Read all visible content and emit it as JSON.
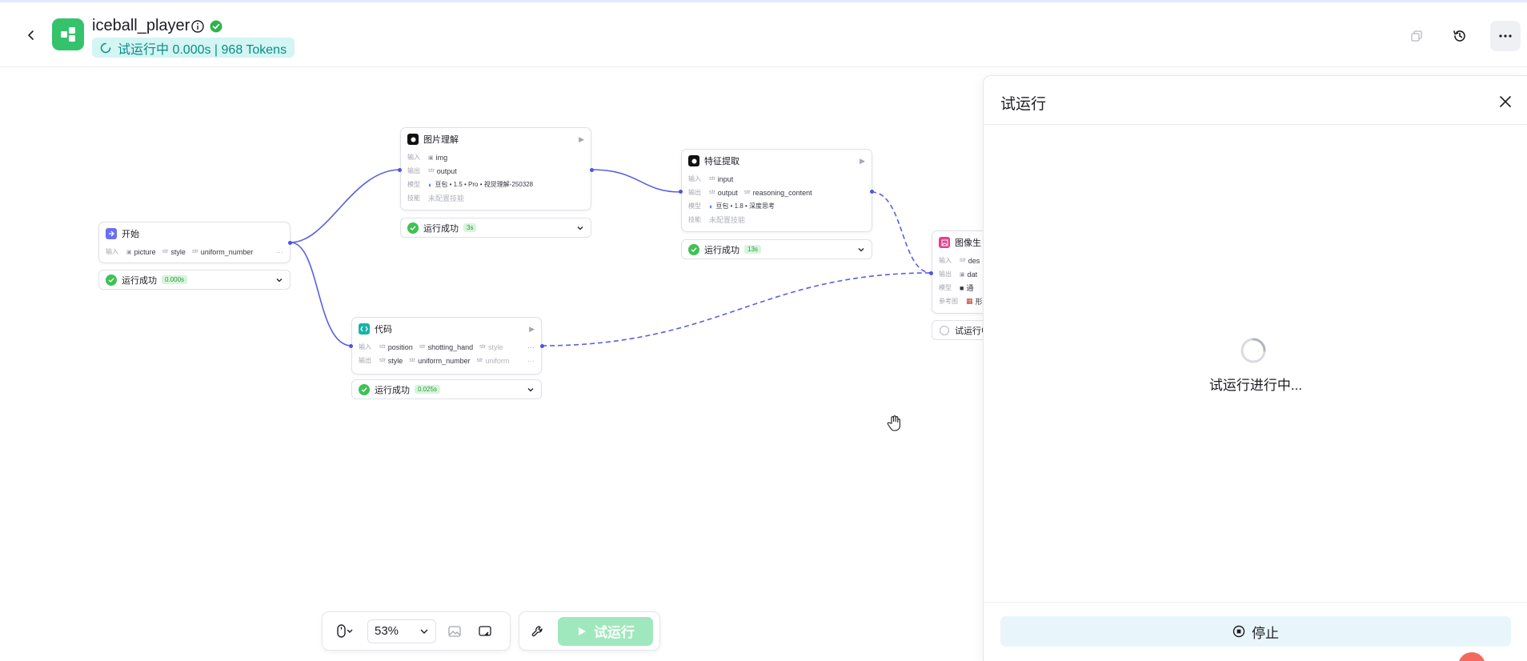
{
  "header": {
    "title": "iceball_player",
    "run_status": "试运行中 0.000s | 968 Tokens"
  },
  "nodes": {
    "start": {
      "title": "开始",
      "input_label": "输入",
      "inputs": [
        "picture",
        "style",
        "uniform_number"
      ],
      "more": "···",
      "status": "运行成功",
      "time": "0.000s"
    },
    "image_understand": {
      "title": "图片理解",
      "input_label": "输入",
      "input": "img",
      "output_label": "输出",
      "output": "output",
      "model_label": "模型",
      "model": "豆包 • 1.5 • Pro • 视觉理解-250328",
      "skill_label": "技能",
      "skill": "未配置技能",
      "status": "运行成功",
      "time": "3s"
    },
    "feature_extract": {
      "title": "特征提取",
      "input_label": "输入",
      "input": "input",
      "output_label": "输出",
      "outputs": [
        "output",
        "reasoning_content"
      ],
      "model_label": "模型",
      "model": "豆包 • 1.8 • 深度思考",
      "skill_label": "技能",
      "skill": "未配置技能",
      "status": "运行成功",
      "time": "13s"
    },
    "code": {
      "title": "代码",
      "input_label": "输入",
      "inputs": [
        "position",
        "shotting_hand",
        "style"
      ],
      "output_label": "输出",
      "outputs": [
        "style",
        "uniform_number",
        "uniform"
      ],
      "more": "···",
      "status": "运行成功",
      "time": "0.025s"
    },
    "image_gen": {
      "title": "图像生",
      "input_label": "输入",
      "input": "des",
      "output_label": "输出",
      "output": "dat",
      "model_label": "模型",
      "model": "通",
      "ref_label": "参考图",
      "ref": "形",
      "status": "试运行中"
    }
  },
  "toolbar": {
    "zoom": "53%",
    "run_label": "试运行"
  },
  "panel": {
    "title": "试运行",
    "running_text": "试运行进行中...",
    "stop_label": "停止"
  }
}
